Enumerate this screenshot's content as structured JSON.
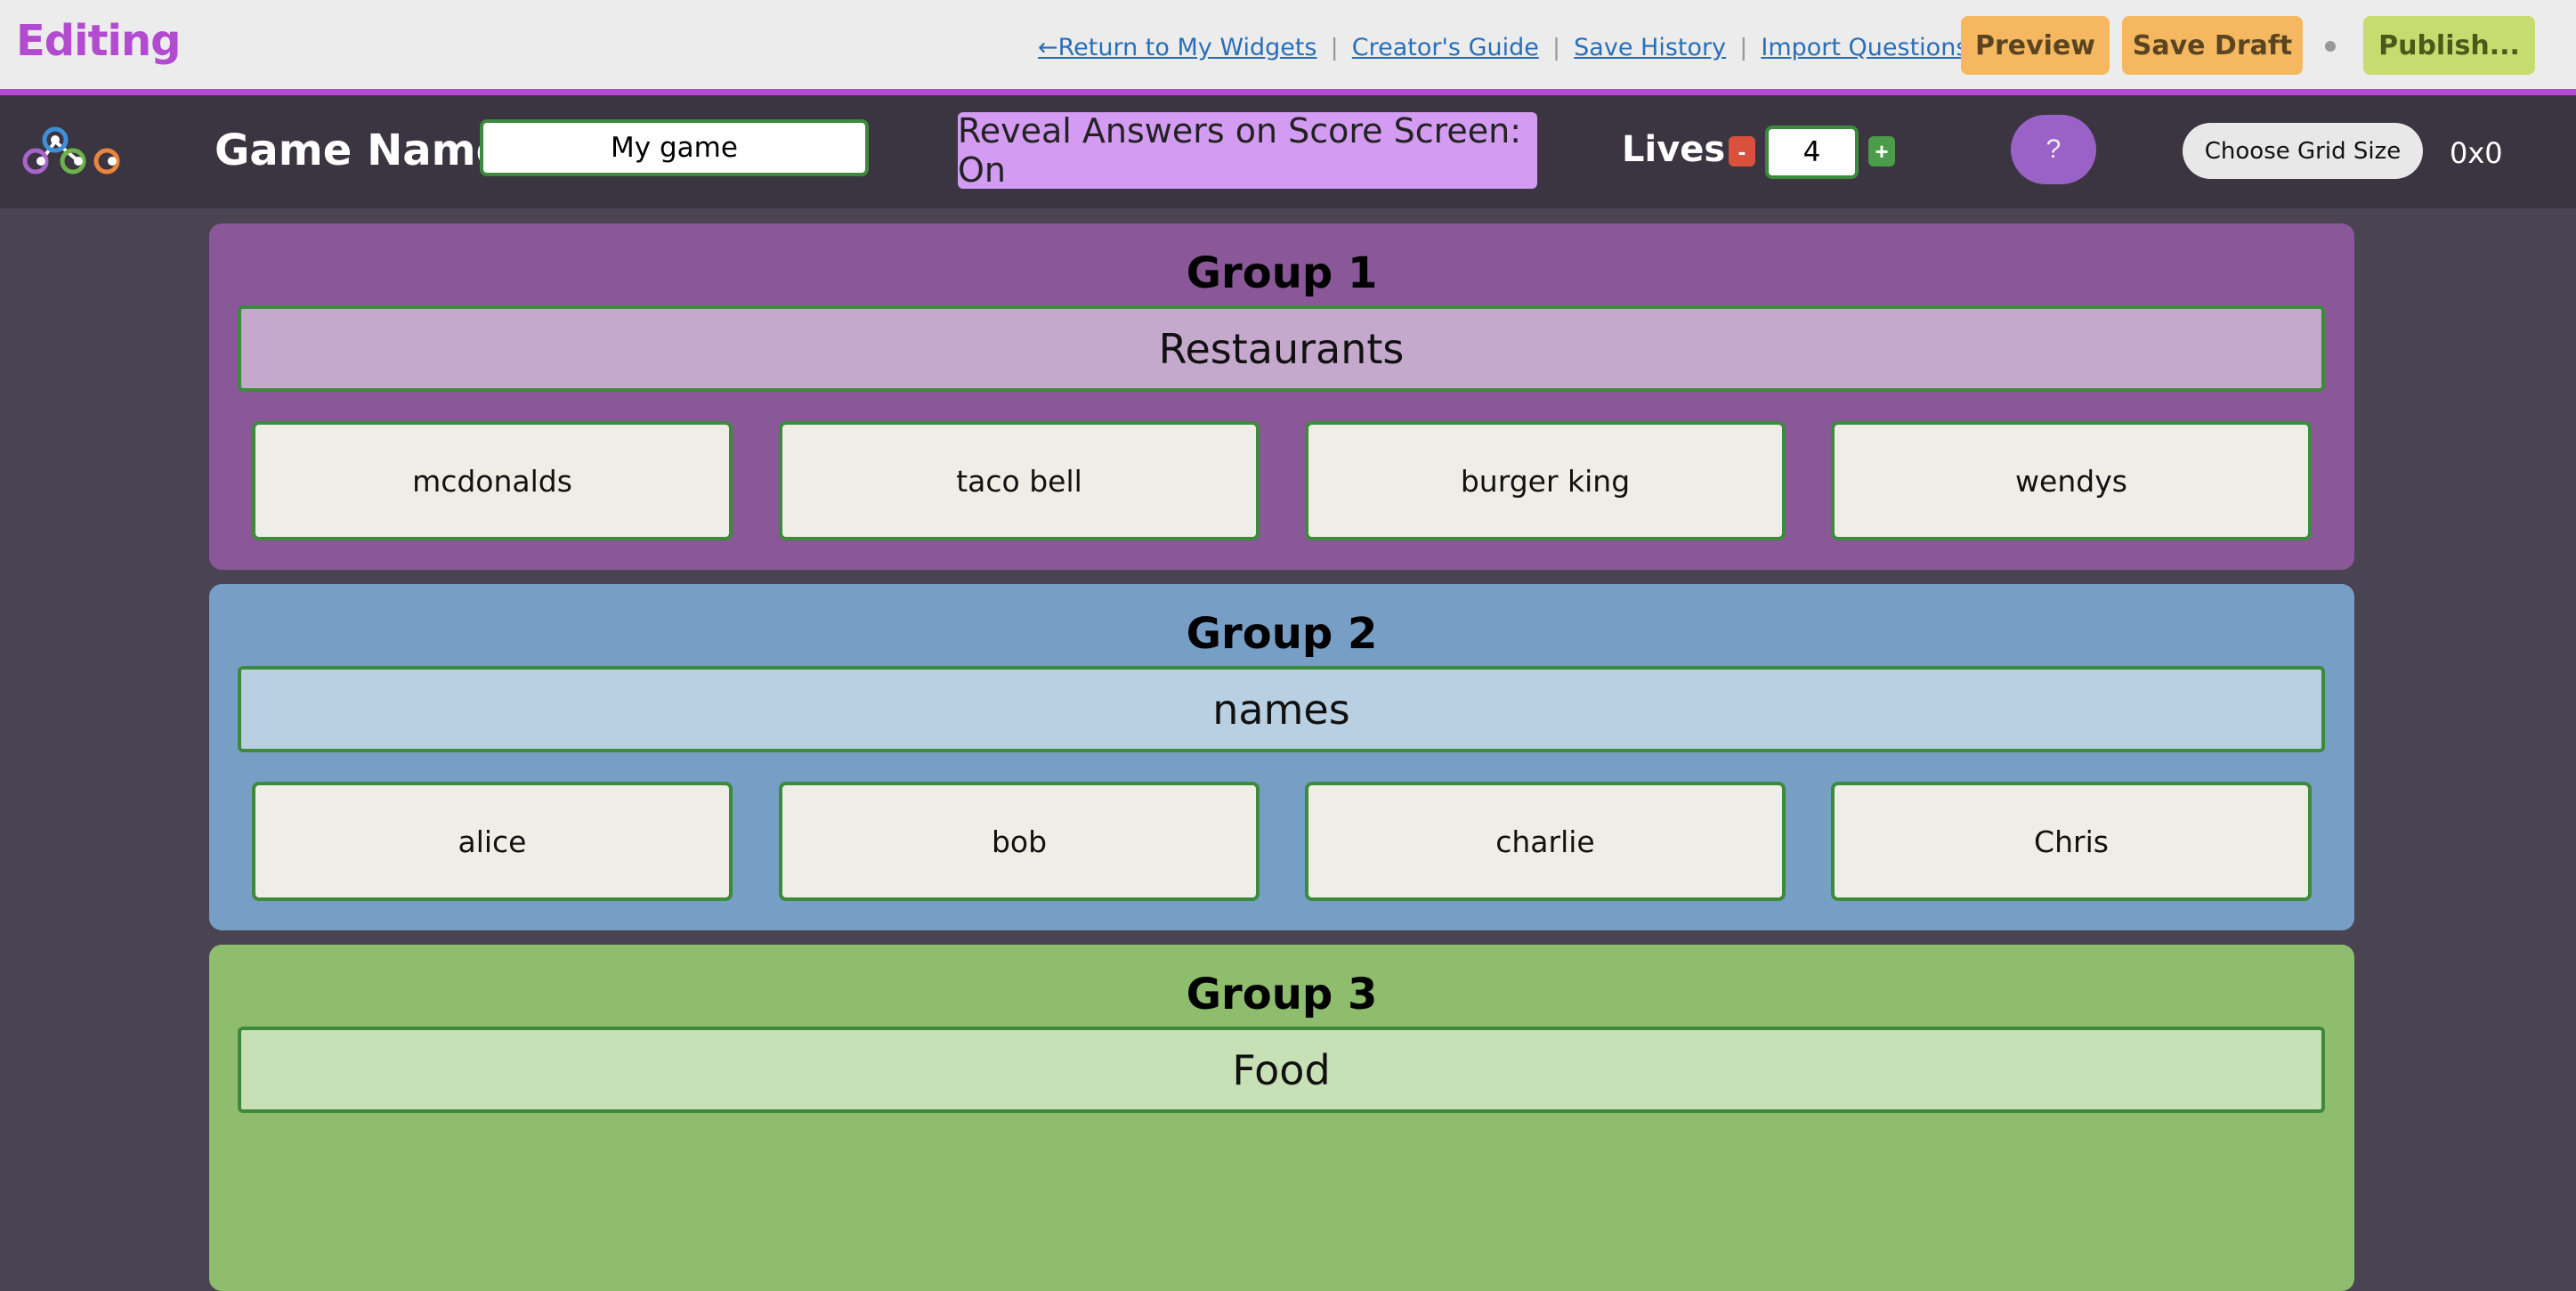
{
  "topbar": {
    "title": "Editing",
    "links": [
      "←Return to My Widgets",
      "Creator's Guide",
      "Save History",
      "Import Questions..."
    ],
    "preview_label": "Preview",
    "save_draft_label": "Save Draft",
    "publish_label": "Publish..."
  },
  "game": {
    "name_label": "Game Name",
    "name_value": "My game",
    "reveal_label": "Reveal Answers on Score Screen: On",
    "lives_label": "Lives",
    "lives_minus": "-",
    "lives_plus": "+",
    "lives_value": "4",
    "help_label": "?",
    "grid_button_label": "Choose Grid Size",
    "grid_size": "0x0"
  },
  "groups": [
    {
      "title": "Group 1",
      "name": "Restaurants",
      "items": [
        "mcdonalds",
        "taco bell",
        "burger king",
        "wendys"
      ],
      "color": "#8a5898",
      "name_bg": "#c5a9cd"
    },
    {
      "title": "Group 2",
      "name": "names",
      "items": [
        "alice",
        "bob",
        "charlie",
        "Chris"
      ],
      "color": "#779ec5",
      "name_bg": "#b9cfe2"
    },
    {
      "title": "Group 3",
      "name": "Food",
      "items": [],
      "color": "#8fbd6e",
      "name_bg": "#c8e0b5"
    }
  ],
  "colors": {
    "accent": "#b24bd0",
    "input_border": "#3c8a3c",
    "orange_button": "#f5b861",
    "publish_button": "#c6dc6f"
  }
}
